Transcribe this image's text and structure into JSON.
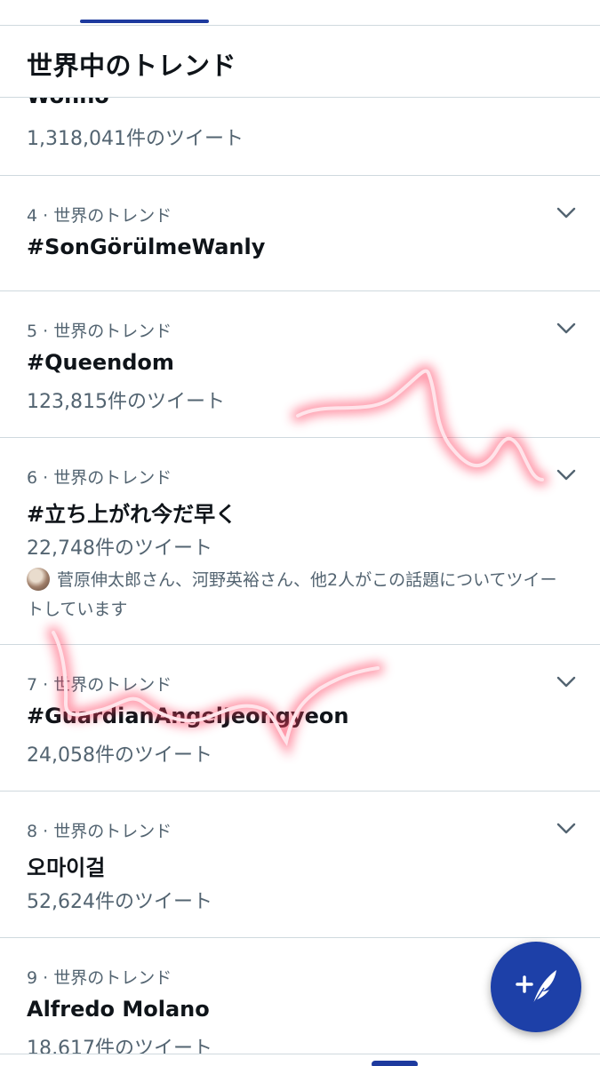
{
  "header": {
    "title": "世界中のトレンド"
  },
  "partial_trend": {
    "name": "Wonho",
    "count": "1,318,041件のツイート"
  },
  "trends": [
    {
      "meta": "4 · 世界のトレンド",
      "name": "#SonGörülmeWanly",
      "count": ""
    },
    {
      "meta": "5 · 世界のトレンド",
      "name": "#Queendom",
      "count": "123,815件のツイート"
    },
    {
      "meta": "6 · 世界のトレンド",
      "name": "#立ち上がれ今だ早く",
      "count": "22,748件のツイート",
      "context": "菅原伸太郎さん、河野英裕さん、他2人がこの話題についてツイートしています"
    },
    {
      "meta": "7 · 世界のトレンド",
      "name": "#GuardianAngelJeongyeon",
      "count": "24,058件のツイート"
    },
    {
      "meta": "8 · 世界のトレンド",
      "name": "오마이걸",
      "count": "52,624件のツイート"
    },
    {
      "meta": "9 · 世界のトレンド",
      "name": "Alfredo Molano",
      "count": "18,617件のツイート"
    }
  ],
  "icons": {
    "trend_menu": "chevron-down-icon",
    "compose": "compose-tweet-icon"
  },
  "colors": {
    "accent": "#1d40a8",
    "text_primary": "#0f1419",
    "text_secondary": "#536471",
    "divider": "#cfd9de",
    "scribble_glow": "#ff3b5c"
  }
}
